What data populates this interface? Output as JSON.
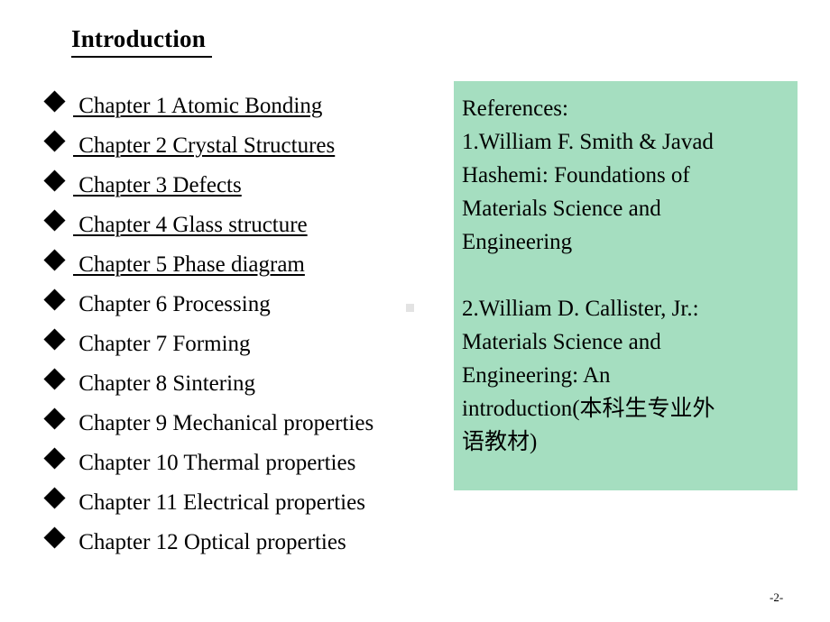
{
  "slide": {
    "title": "Introduction ",
    "page_number": "-2-",
    "background_color": "#ffffff"
  },
  "chapters": [
    {
      "bullet": "diamond-bullet",
      "label": " Chapter 1 Atomic Bonding",
      "underlined": true
    },
    {
      "bullet": "diamond-bullet",
      "label": " Chapter 2 Crystal Structures",
      "underlined": true
    },
    {
      "bullet": "diamond-bullet",
      "label": " Chapter 3 Defects",
      "underlined": true
    },
    {
      "bullet": "diamond-bullet",
      "label": " Chapter 4 Glass structure",
      "underlined": true
    },
    {
      "bullet": "diamond-bullet",
      "label": " Chapter 5 Phase diagram",
      "underlined": true
    },
    {
      "bullet": "diamond-bullet",
      "label": " Chapter 6 Processing",
      "underlined": false
    },
    {
      "bullet": "diamond-bullet",
      "label": " Chapter 7 Forming",
      "underlined": false
    },
    {
      "bullet": "diamond-bullet",
      "label": " Chapter 8 Sintering",
      "underlined": false
    },
    {
      "bullet": "diamond-bullet",
      "label": " Chapter 9 Mechanical properties",
      "underlined": false
    },
    {
      "bullet": "diamond-bullet",
      "label": " Chapter 10 Thermal properties",
      "underlined": false
    },
    {
      "bullet": "diamond-bullet",
      "label": " Chapter 11 Electrical properties",
      "underlined": false
    },
    {
      "bullet": "diamond-bullet",
      "label": " Chapter 12 Optical properties",
      "underlined": false
    }
  ],
  "references": {
    "background_color": "#a5dec0",
    "heading": "References:",
    "lines": [
      "1.William F. Smith & Javad",
      "Hashemi: Foundations of",
      "Materials Science and",
      "Engineering",
      "",
      "2.William D. Callister, Jr.:",
      "Materials Science and",
      "Engineering: An",
      "introduction(本科生专业外",
      "语教材)"
    ]
  }
}
